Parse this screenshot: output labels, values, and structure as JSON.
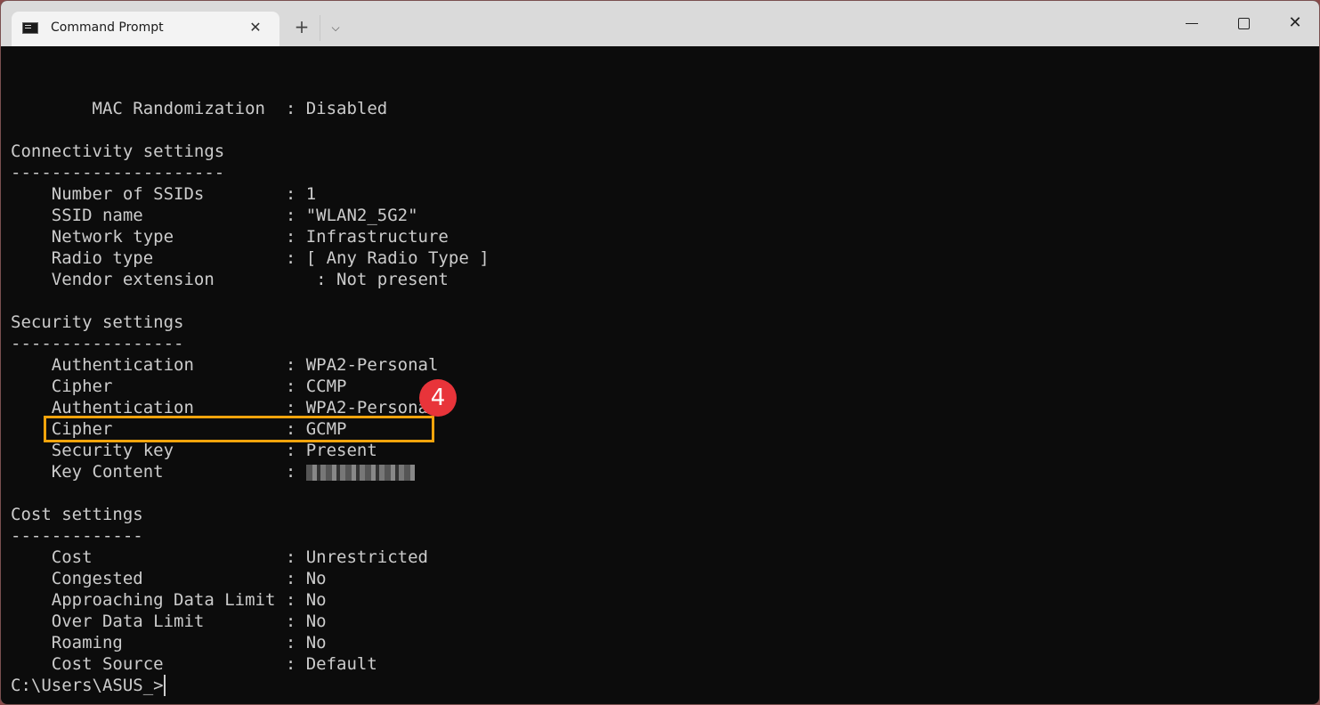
{
  "window": {
    "tab_title": "Command Prompt",
    "tab_icon": "terminal-icon",
    "new_tab_icon": "+",
    "dropdown_icon": "⌵",
    "close_tab_icon": "✕",
    "minimize_icon": "minimize-icon",
    "maximize_icon": "maximize-icon",
    "close_icon": "✕"
  },
  "terminal": {
    "lines": [
      "        MAC Randomization  : Disabled",
      "",
      "Connectivity settings",
      "---------------------",
      "    Number of SSIDs        : 1",
      "    SSID name              : \"WLAN2_5G2\"",
      "    Network type           : Infrastructure",
      "    Radio type             : [ Any Radio Type ]",
      "    Vendor extension          : Not present",
      "",
      "Security settings",
      "-----------------",
      "    Authentication         : WPA2-Personal",
      "    Cipher                 : CCMP",
      "    Authentication         : WPA2-Personal",
      "    Cipher                 : GCMP",
      "    Security key           : Present",
      "    Key Content            : ",
      "",
      "Cost settings",
      "-------------",
      "    Cost                   : Unrestricted",
      "    Congested              : No",
      "    Approaching Data Limit : No",
      "    Over Data Limit        : No",
      "    Roaming                : No",
      "    Cost Source            : Default"
    ],
    "key_content_redacted": true,
    "prompt": "C:\\Users\\ASUS_>"
  },
  "annotation": {
    "step_number": "4",
    "highlight_color": "#f5a40c",
    "badge_color": "#e8343a"
  }
}
